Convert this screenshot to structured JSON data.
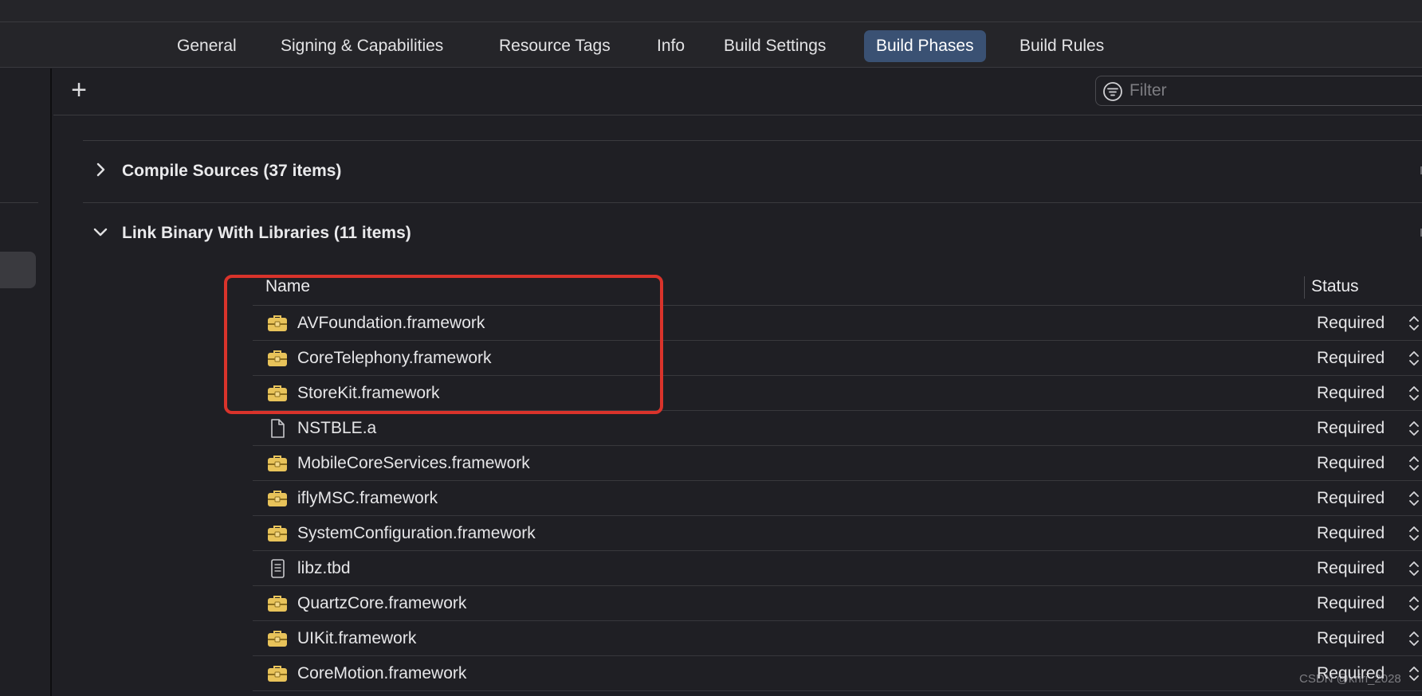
{
  "tabs": [
    {
      "label": "General",
      "active": false
    },
    {
      "label": "Signing & Capabilities",
      "active": false
    },
    {
      "label": "Resource Tags",
      "active": false
    },
    {
      "label": "Info",
      "active": false
    },
    {
      "label": "Build Settings",
      "active": false
    },
    {
      "label": "Build Phases",
      "active": true
    },
    {
      "label": "Build Rules",
      "active": false
    }
  ],
  "toolbar": {
    "add_label": "+",
    "filter_placeholder": "Filter"
  },
  "phases": [
    {
      "title": "Compile Sources (37 items)",
      "expanded": false
    },
    {
      "title": "Link Binary With Libraries (11 items)",
      "expanded": true
    }
  ],
  "library_table": {
    "columns": {
      "name": "Name",
      "status": "Status"
    },
    "rows": [
      {
        "name": "AVFoundation.framework",
        "status": "Required",
        "icon": "framework-icon"
      },
      {
        "name": "CoreTelephony.framework",
        "status": "Required",
        "icon": "framework-icon"
      },
      {
        "name": "StoreKit.framework",
        "status": "Required",
        "icon": "framework-icon"
      },
      {
        "name": "NSTBLE.a",
        "status": "Required",
        "icon": "file-icon"
      },
      {
        "name": "MobileCoreServices.framework",
        "status": "Required",
        "icon": "framework-icon"
      },
      {
        "name": "iflyMSC.framework",
        "status": "Required",
        "icon": "framework-icon"
      },
      {
        "name": "SystemConfiguration.framework",
        "status": "Required",
        "icon": "framework-icon"
      },
      {
        "name": "libz.tbd",
        "status": "Required",
        "icon": "text-file-icon"
      },
      {
        "name": "QuartzCore.framework",
        "status": "Required",
        "icon": "framework-icon"
      },
      {
        "name": "UIKit.framework",
        "status": "Required",
        "icon": "framework-icon"
      },
      {
        "name": "CoreMotion.framework",
        "status": "Required",
        "icon": "framework-icon"
      }
    ]
  },
  "watermark": "CSDN @kriri_2028",
  "colors": {
    "background": "#1f1f24",
    "active_tab": "#3a5173",
    "framework_icon": "#e8c35a",
    "highlight": "#d9332b"
  }
}
